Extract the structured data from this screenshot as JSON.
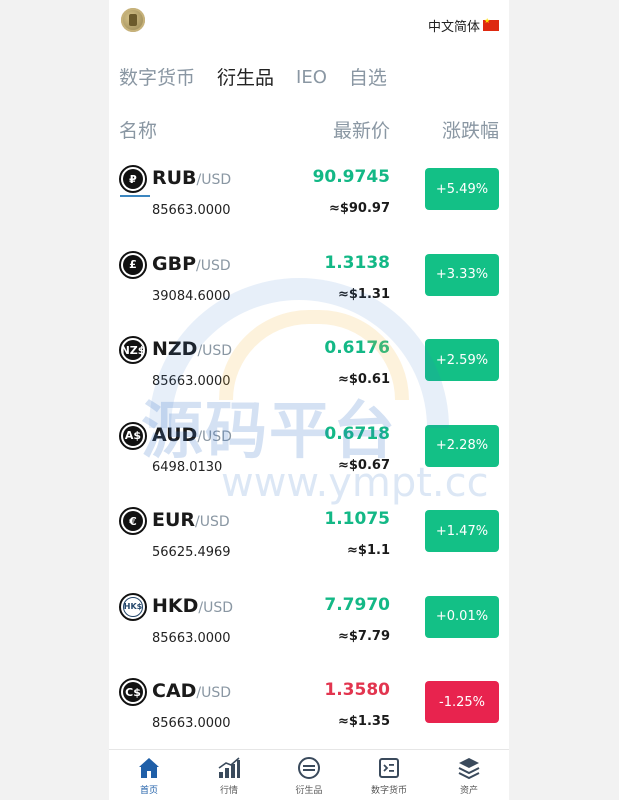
{
  "header": {
    "language": "中文简体"
  },
  "tabs": [
    {
      "label": "数字货币",
      "active": false
    },
    {
      "label": "衍生品",
      "active": true
    },
    {
      "label": "IEO",
      "active": false
    },
    {
      "label": "自选",
      "active": false
    }
  ],
  "columns": {
    "name": "名称",
    "price": "最新价",
    "change": "涨跌幅"
  },
  "rows": [
    {
      "base": "RUB",
      "quote": "/USD",
      "volume": "85663.0000",
      "price": "90.9745",
      "usd": "≈$90.97",
      "change": "+5.49%",
      "direction": "up",
      "icon_symbol": "₽",
      "icon": "ruble-icon"
    },
    {
      "base": "GBP",
      "quote": "/USD",
      "volume": "39084.6000",
      "price": "1.3138",
      "usd": "≈$1.31",
      "change": "+3.33%",
      "direction": "up",
      "icon_symbol": "£",
      "icon": "pound-icon"
    },
    {
      "base": "NZD",
      "quote": "/USD",
      "volume": "85663.0000",
      "price": "0.6176",
      "usd": "≈$0.61",
      "change": "+2.59%",
      "direction": "up",
      "icon_symbol": "NZ$",
      "icon": "nzd-icon"
    },
    {
      "base": "AUD",
      "quote": "/USD",
      "volume": "6498.0130",
      "price": "0.6718",
      "usd": "≈$0.67",
      "change": "+2.28%",
      "direction": "up",
      "icon_symbol": "A$",
      "icon": "aud-icon"
    },
    {
      "base": "EUR",
      "quote": "/USD",
      "volume": "56625.4969",
      "price": "1.1075",
      "usd": "≈$1.1",
      "change": "+1.47%",
      "direction": "up",
      "icon_symbol": "€",
      "icon": "euro-icon"
    },
    {
      "base": "HKD",
      "quote": "/USD",
      "volume": "85663.0000",
      "price": "7.7970",
      "usd": "≈$7.79",
      "change": "+0.01%",
      "direction": "up",
      "icon_symbol": "HK$",
      "icon": "hkd-icon"
    },
    {
      "base": "CAD",
      "quote": "/USD",
      "volume": "85663.0000",
      "price": "1.3580",
      "usd": "≈$1.35",
      "change": "-1.25%",
      "direction": "down",
      "icon_symbol": "C$",
      "icon": "cad-icon"
    }
  ],
  "watermark": {
    "text": "源码平台",
    "url": "www.ympt.cc"
  },
  "nav": [
    {
      "label": "首页",
      "icon": "home-icon",
      "active": true
    },
    {
      "label": "行情",
      "icon": "chart-icon",
      "active": false
    },
    {
      "label": "衍生品",
      "icon": "derivatives-icon",
      "active": false
    },
    {
      "label": "数字货币",
      "icon": "digital-currency-icon",
      "active": false
    },
    {
      "label": "资产",
      "icon": "assets-icon",
      "active": false
    }
  ],
  "colors": {
    "up": "#13c086",
    "down": "#e8234e",
    "nav_active": "#1f5fa8"
  }
}
